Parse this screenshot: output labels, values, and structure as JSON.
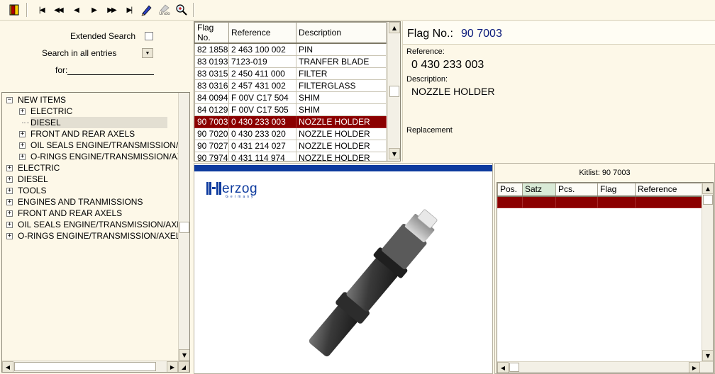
{
  "toolbar": {
    "buttons": [
      {
        "name": "exit-icon",
        "glyph": ""
      },
      {
        "name": "first-record-icon",
        "glyph": "|◀"
      },
      {
        "name": "previous-page-icon",
        "glyph": "◀◀"
      },
      {
        "name": "previous-record-icon",
        "glyph": "◀"
      },
      {
        "name": "next-record-icon",
        "glyph": "▶"
      },
      {
        "name": "next-page-icon",
        "glyph": "▶▶"
      },
      {
        "name": "last-record-icon",
        "glyph": "▶|"
      }
    ],
    "undo_label": "Undo"
  },
  "search": {
    "extended_label": "Extended Search",
    "scope_value": "Search in all entries",
    "for_label": "for:",
    "for_value": ""
  },
  "tree": {
    "items": [
      {
        "label": "NEW ITEMS",
        "expander": "−",
        "level": 0
      },
      {
        "label": "ELECTRIC",
        "expander": "+",
        "level": 1
      },
      {
        "label": "DIESEL",
        "expander": "",
        "level": 1,
        "selected": true
      },
      {
        "label": "FRONT AND REAR AXELS",
        "expander": "+",
        "level": 1
      },
      {
        "label": "OIL SEALS  ENGINE/TRANSMISSION/AX",
        "expander": "+",
        "level": 1
      },
      {
        "label": "O-RINGS ENGINE/TRANSMISSION/AXEL",
        "expander": "+",
        "level": 1
      },
      {
        "label": "ELECTRIC",
        "expander": "+",
        "level": 0
      },
      {
        "label": "DIESEL",
        "expander": "+",
        "level": 0
      },
      {
        "label": "TOOLS",
        "expander": "+",
        "level": 0
      },
      {
        "label": "ENGINES AND TRANMISSIONS",
        "expander": "+",
        "level": 0
      },
      {
        "label": "FRONT AND REAR AXELS",
        "expander": "+",
        "level": 0
      },
      {
        "label": "OIL SEALS  ENGINE/TRANSMISSION/AXEL",
        "expander": "+",
        "level": 0
      },
      {
        "label": "O-RINGS ENGINE/TRANSMISSION/AXEL",
        "expander": "+",
        "level": 0
      }
    ]
  },
  "parts": {
    "columns": [
      "Flag No.",
      "Reference",
      "Description"
    ],
    "rows": [
      [
        "82 1858",
        "2 463 100 002",
        "PIN"
      ],
      [
        "83 0193",
        "7123-019",
        "TRANFER BLADE"
      ],
      [
        "83 0315",
        "2 450 411 000",
        "FILTER"
      ],
      [
        "83 0316",
        "2 457 431 002",
        "FILTERGLASS"
      ],
      [
        "84 0094",
        "F 00V C17 504",
        "SHIM"
      ],
      [
        "84 0129",
        "F 00V C17 505",
        "SHIM"
      ],
      [
        "90 7003",
        "0 430 233 003",
        "NOZZLE HOLDER"
      ],
      [
        "90 7020",
        "0 430 233 020",
        "NOZZLE HOLDER"
      ],
      [
        "90 7027",
        "0 431 214 027",
        "NOZZLE HOLDER"
      ],
      [
        "90 7974",
        "0 431 114 974",
        "NOZZLE HOLDER"
      ]
    ],
    "selected_row": 6
  },
  "detail": {
    "flag_label": "Flag No.:",
    "flag_value": "90 7003",
    "reference_label": "Reference:",
    "reference_value": "0 430 233 003",
    "description_label": "Description:",
    "description_value": "NOZZLE HOLDER",
    "replacement_label": "Replacement"
  },
  "image": {
    "brand": "Herzog",
    "brand_sub": "Germany"
  },
  "kitlist": {
    "title": "Kitlist: 90 7003",
    "columns": [
      "Pos.",
      "Satz",
      "Pcs.",
      "Flag",
      "Reference"
    ]
  },
  "colors": {
    "selection": "#8b0000",
    "brand_blue": "#0d3a9e",
    "panel_bg": "#fdf8e8"
  }
}
